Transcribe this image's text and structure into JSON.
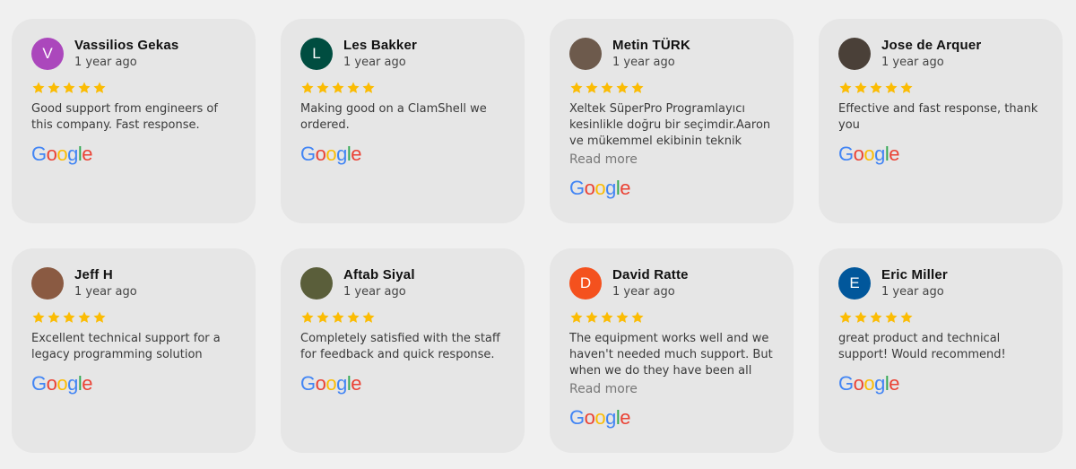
{
  "reviews": [
    {
      "name": "Vassilios Gekas",
      "time": "1 year ago",
      "avatar_letter": "V",
      "avatar_color": "#ab47bc",
      "text": "Good support from engineers of this company. Fast response.",
      "read_more": "",
      "rating": 5
    },
    {
      "name": "Les Bakker",
      "time": "1 year ago",
      "avatar_letter": "L",
      "avatar_color": "#004d40",
      "text": "Making good on a ClamShell we ordered.",
      "read_more": "",
      "rating": 5
    },
    {
      "name": "Metin TÜRK",
      "time": "1 year ago",
      "avatar_letter": "",
      "avatar_color": "#6d5a4c",
      "text": "Xeltek SüperPro Programlayıcı kesinlikle doğru bir seçimdir.Aaron ve mükemmel ekibinin teknik",
      "read_more": "Read more",
      "rating": 5
    },
    {
      "name": "Jose de Arquer",
      "time": "1 year ago",
      "avatar_letter": "",
      "avatar_color": "#4a4038",
      "text": "Effective and fast response, thank you",
      "read_more": "",
      "rating": 5
    },
    {
      "name": "Jeff H",
      "time": "1 year ago",
      "avatar_letter": "",
      "avatar_color": "#8a5a42",
      "text": "Excellent technical support for a legacy programming solution",
      "read_more": "",
      "rating": 5
    },
    {
      "name": "Aftab Siyal",
      "time": "1 year ago",
      "avatar_letter": "",
      "avatar_color": "#5a5e3a",
      "text": "Completely satisfied with the staff for feedback and quick response.",
      "read_more": "",
      "rating": 5
    },
    {
      "name": "David Ratte",
      "time": "1 year ago",
      "avatar_letter": "D",
      "avatar_color": "#f4511e",
      "text": "The equipment works well and we haven't needed much support. But when we do they have been all over",
      "read_more": "Read more",
      "rating": 5
    },
    {
      "name": "Eric Miller",
      "time": "1 year ago",
      "avatar_letter": "E",
      "avatar_color": "#01579b",
      "text": "great product and technical support! Would recommend!",
      "read_more": "",
      "rating": 5
    }
  ],
  "colors": {
    "star": "#fbbc04",
    "card": "#e6e6e6",
    "background": "#f0f0f0"
  },
  "icons": {
    "star": "star-icon",
    "logo": "google-logo"
  },
  "logo_text": "Google"
}
